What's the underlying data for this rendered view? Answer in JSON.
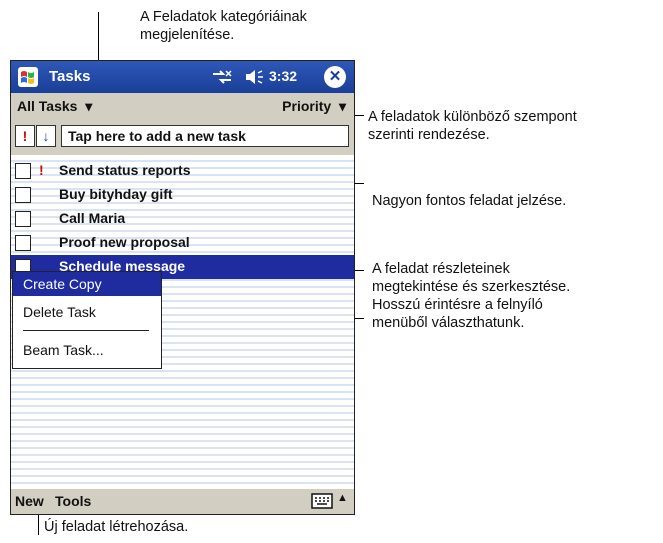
{
  "callouts": {
    "top": "A Feladatok kategóriáinak\nmegjelenítése.",
    "sort": "A feladatok különböző szempont\nszerinti rendezése.",
    "priority": "Nagyon fontos feladat jelzése.",
    "details": "A feladat részleteinek\nmegtekintése és szerkesztése.\nHosszú érintésre a felnyíló\nmenüből választhatunk.",
    "new": "Új feladat létrehozása."
  },
  "device": {
    "title": "Tasks",
    "time": "3:32",
    "close_label": "✕",
    "nav": {
      "category": "All Tasks",
      "sort": "Priority"
    },
    "entry": {
      "priority_glyph": "!",
      "sort_glyph": "↓",
      "placeholder": "Tap here to add a new task"
    },
    "tasks": [
      {
        "label": "Send status reports",
        "high_priority": true
      },
      {
        "label": "Buy bityhday gift",
        "high_priority": false
      },
      {
        "label": "Call Maria",
        "high_priority": false
      },
      {
        "label": "Proof new proposal",
        "high_priority": false
      },
      {
        "label": "Schedule message",
        "high_priority": false,
        "selected": true
      }
    ],
    "context_menu": [
      "Create Copy",
      "Delete Task",
      "Beam Task..."
    ],
    "command_bar": {
      "new": "New",
      "tools": "Tools"
    }
  },
  "colors": {
    "title_bar": "#1f4aa8",
    "selection": "#1f2ca0",
    "priority": "#c01010",
    "bar_bg": "#d3cec2"
  }
}
